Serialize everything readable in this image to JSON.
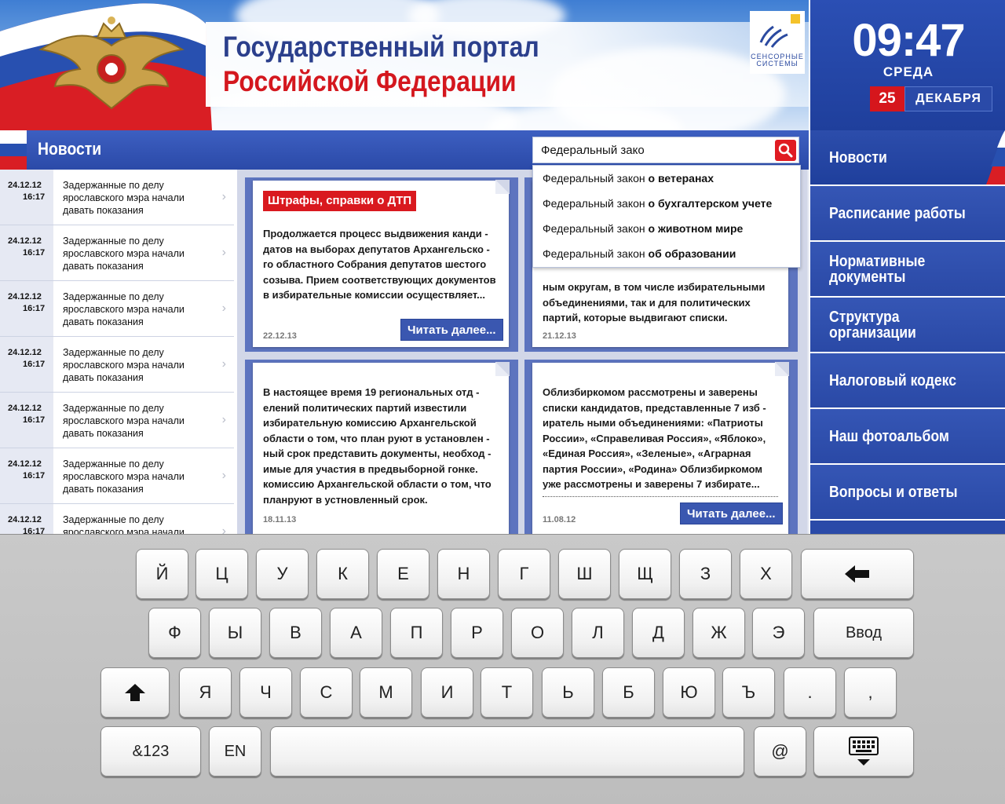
{
  "header": {
    "title_line1": "Государственный портал",
    "title_line2": "Российской Федерации",
    "logo_text_1": "СЕНСОРНЫЕ",
    "logo_text_2": "СИСТЕМЫ"
  },
  "clock": {
    "time": "09:47",
    "weekday": "СРЕДА",
    "day": "25",
    "month": "ДЕКАБРЯ"
  },
  "section": {
    "title": "Новости"
  },
  "search": {
    "value": "Федеральный зако",
    "suggestions": [
      {
        "prefix": "Федеральный закон",
        "rest": " о ветеранах"
      },
      {
        "prefix": "Федеральный закон",
        "rest": " о бухгалтерском учете"
      },
      {
        "prefix": "Федеральный закон",
        "rest": " о животном мире"
      },
      {
        "prefix": "Федеральный закон",
        "rest": " об образовании"
      }
    ]
  },
  "news": [
    {
      "date": "24.12.12",
      "time": "16:17",
      "text": "Задержанные по делу ярославского мэра начали давать показания"
    },
    {
      "date": "24.12.12",
      "time": "16:17",
      "text": "Задержанные по делу ярославского мэра начали давать показания"
    },
    {
      "date": "24.12.12",
      "time": "16:17",
      "text": "Задержанные по делу ярославского мэра начали давать показания"
    },
    {
      "date": "24.12.12",
      "time": "16:17",
      "text": "Задержанные по делу ярославского мэра начали давать показания"
    },
    {
      "date": "24.12.12",
      "time": "16:17",
      "text": "Задержанные по делу ярославского мэра начали давать показания"
    },
    {
      "date": "24.12.12",
      "time": "16:17",
      "text": "Задержанные по делу ярославского мэра начали давать показания"
    },
    {
      "date": "24.12.12",
      "time": "16:17",
      "text": "Задержанные по делу ярославского мэра начали давать показания"
    }
  ],
  "cards": [
    {
      "badge": "Штрафы, справки о ДТП",
      "lines": [
        "Продолжается процесс выдвижения канди -",
        "датов на выборах депутатов Архангельско -",
        "го областного Собрания депутатов шестого",
        "созыва. Прием соответствующих документов",
        "в избирательные комиссии осуществляет..."
      ],
      "date": "22.12.13",
      "more": "Читать далее..."
    },
    {
      "lines": [
        "ным округам, в том числе избирательными",
        "объединениями, так и для политических",
        "партий, которые выдвигают списки."
      ],
      "date": "21.12.13"
    },
    {
      "lines": [
        "В настоящее время 19 региональных отд -",
        "елений политических партий известили",
        "избирательную комиссию Архангельской",
        "области о том, что план руют в установлен -",
        "ный срок представить документы, необход -",
        "имые для участия в предвыборной гонке.",
        "комиссию Архангельской области о том, что",
        "планруют в устновленный срок."
      ],
      "date": "18.11.13"
    },
    {
      "lines": [
        "Облизбиркомом  рассмотрены и заверены",
        "списки кандидатов, представленные 7 изб -",
        "иратель ными объединениями: «Патриоты",
        "России», «Справеливая Россия», «Яблоко»,",
        "«Единая Россия», «Зеленые», «Аграрная",
        "партия России», «Родина» Облизбиркомом",
        "уже рассмотрены и заверены 7 избирате..."
      ],
      "date": "11.08.12",
      "more": "Читать далее..."
    }
  ],
  "nav": [
    {
      "label": "Новости"
    },
    {
      "label": "Расписание работы"
    },
    {
      "label": "Нормативные документы"
    },
    {
      "label": "Структура организации"
    },
    {
      "label": "Налоговый кодекс"
    },
    {
      "label": "Наш фотоальбом"
    },
    {
      "label": "Вопросы и ответы"
    }
  ],
  "keyboard": {
    "row1": [
      "Й",
      "Ц",
      "У",
      "К",
      "Е",
      "Н",
      "Г",
      "Ш",
      "Щ",
      "З",
      "Х"
    ],
    "row2": [
      "Ф",
      "Ы",
      "В",
      "А",
      "П",
      "Р",
      "О",
      "Л",
      "Д",
      "Ж",
      "Э"
    ],
    "row3": [
      "Я",
      "Ч",
      "С",
      "М",
      "И",
      "Т",
      "Ь",
      "Б",
      "Ю",
      "Ъ",
      ".",
      ","
    ],
    "enter": "Ввод",
    "symbols": "&123",
    "lang": "EN",
    "at": "@"
  },
  "colors": {
    "brand_blue": "#2a4aa8",
    "accent_red": "#d9191f",
    "content_bg": "#d2d7e8"
  }
}
